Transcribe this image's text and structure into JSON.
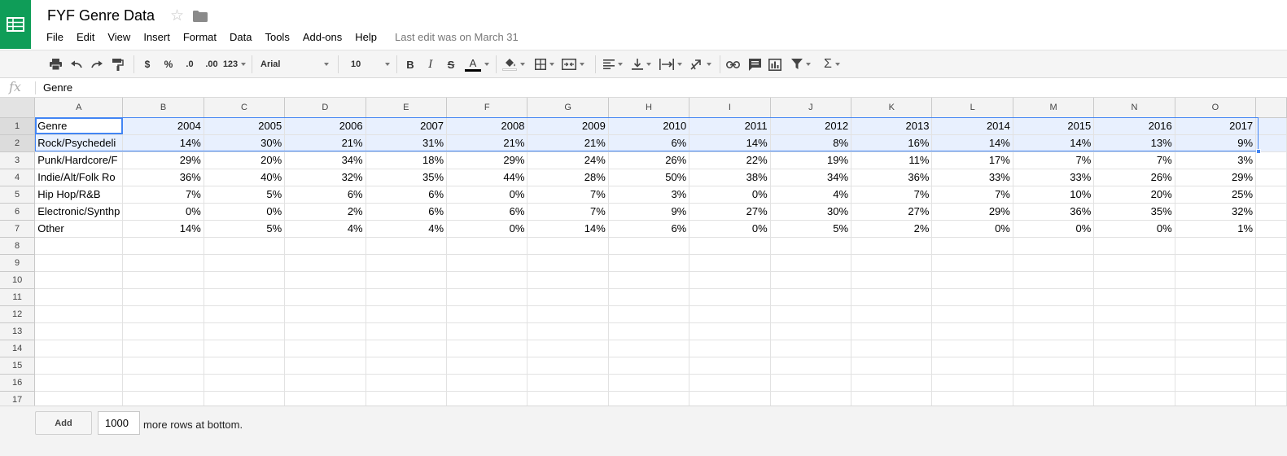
{
  "document": {
    "title": "FYF Genre Data",
    "last_edit": "Last edit was on March 31"
  },
  "menu": [
    "File",
    "Edit",
    "View",
    "Insert",
    "Format",
    "Data",
    "Tools",
    "Add-ons",
    "Help"
  ],
  "toolbar": {
    "currency_label": "$",
    "percent_label": "%",
    "decrease_decimals_label": ".0",
    "increase_decimals_label": ".00",
    "more_formats_label": "123",
    "font": "Arial",
    "font_size": "10",
    "bold_label": "B",
    "italic_label": "I",
    "strikethrough_label": "S",
    "text_color_label": "A",
    "icons": [
      "print-icon",
      "undo-icon",
      "redo-icon",
      "paint-format-icon",
      "fill-color-icon",
      "borders-icon",
      "merge-cells-icon",
      "align-left-icon",
      "valign-bottom-icon",
      "text-wrap-icon",
      "text-rotation-icon",
      "link-icon",
      "comment-icon",
      "chart-icon",
      "filter-icon",
      "functions-icon"
    ]
  },
  "formula_bar": {
    "fx_label": "fx",
    "value": "Genre"
  },
  "grid": {
    "columns": [
      "A",
      "B",
      "C",
      "D",
      "E",
      "F",
      "G",
      "H",
      "I",
      "J",
      "K",
      "L",
      "M",
      "N",
      "O"
    ],
    "rows": [
      [
        "Genre",
        "2004",
        "2005",
        "2006",
        "2007",
        "2008",
        "2009",
        "2010",
        "2011",
        "2012",
        "2013",
        "2014",
        "2015",
        "2016",
        "2017"
      ],
      [
        "Rock/Psychedeli",
        "14%",
        "30%",
        "21%",
        "31%",
        "21%",
        "21%",
        "6%",
        "14%",
        "8%",
        "16%",
        "14%",
        "14%",
        "13%",
        "9%"
      ],
      [
        "Punk/Hardcore/F",
        "29%",
        "20%",
        "34%",
        "18%",
        "29%",
        "24%",
        "26%",
        "22%",
        "19%",
        "11%",
        "17%",
        "7%",
        "7%",
        "3%"
      ],
      [
        "Indie/Alt/Folk Ro",
        "36%",
        "40%",
        "32%",
        "35%",
        "44%",
        "28%",
        "50%",
        "38%",
        "34%",
        "36%",
        "33%",
        "33%",
        "26%",
        "29%"
      ],
      [
        "Hip Hop/R&B",
        "7%",
        "5%",
        "6%",
        "6%",
        "0%",
        "7%",
        "3%",
        "0%",
        "4%",
        "7%",
        "7%",
        "10%",
        "20%",
        "25%"
      ],
      [
        "Electronic/Synthp",
        "0%",
        "0%",
        "2%",
        "6%",
        "6%",
        "7%",
        "9%",
        "27%",
        "30%",
        "27%",
        "29%",
        "36%",
        "35%",
        "32%"
      ],
      [
        "Other",
        "14%",
        "5%",
        "4%",
        "4%",
        "0%",
        "14%",
        "6%",
        "0%",
        "5%",
        "2%",
        "0%",
        "0%",
        "0%",
        "1%"
      ]
    ],
    "total_rows": 17,
    "selected_rows": [
      1,
      2
    ],
    "active_cell": "A1"
  },
  "bottom": {
    "add_label": "Add",
    "rows_value": "1000",
    "rows_label": "more rows at bottom."
  },
  "colors": {
    "brand_green": "#0f9d58",
    "selection_blue": "#4285f4",
    "selection_fill": "#e8f0fe"
  }
}
